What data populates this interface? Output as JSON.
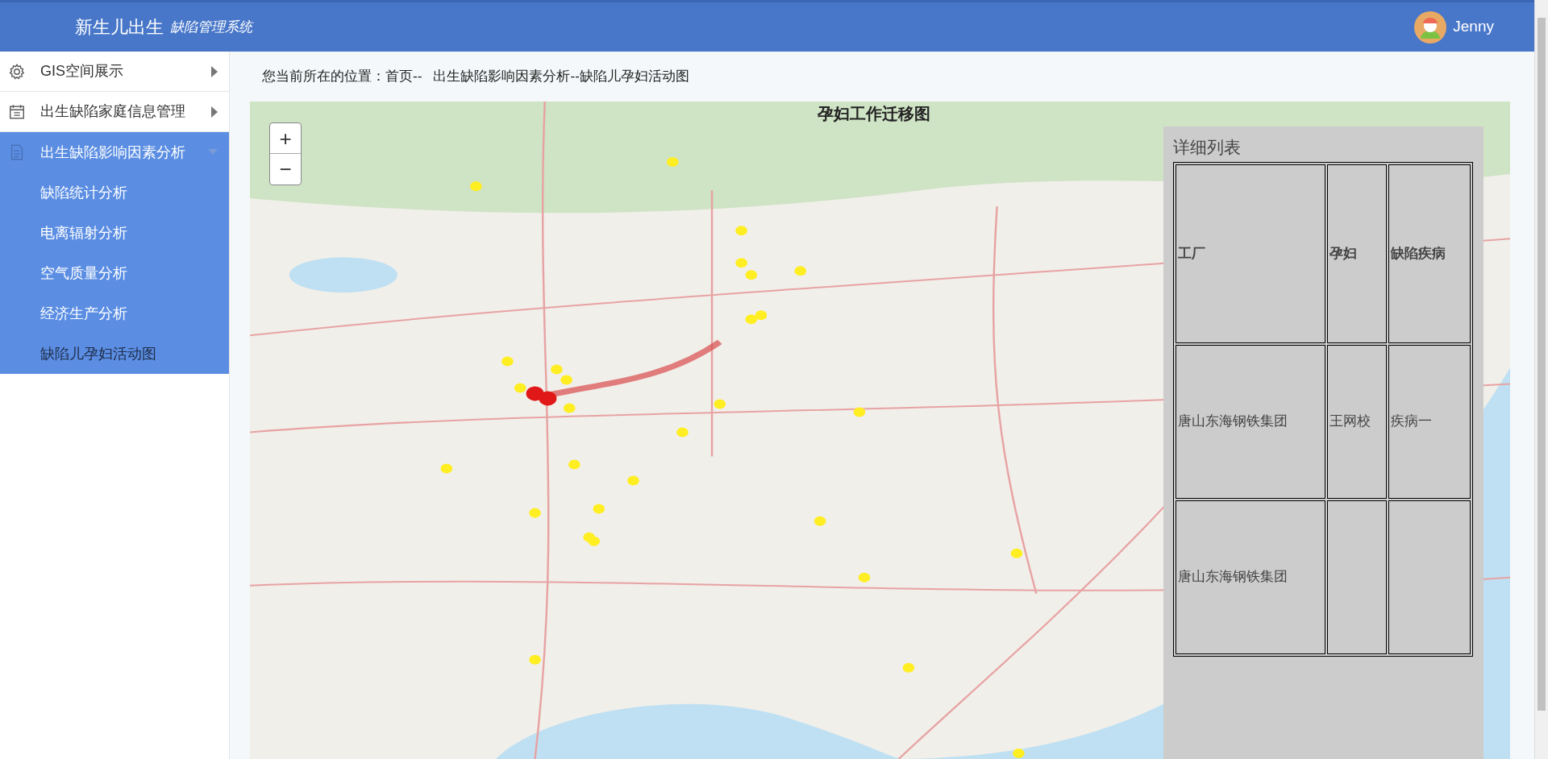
{
  "header": {
    "title": "新生儿出生",
    "subtitle": "缺陷管理系统",
    "user": "Jenny"
  },
  "sidebar": {
    "items": [
      {
        "label": "GIS空间展示",
        "kind": "gear",
        "expanded": false
      },
      {
        "label": "出生缺陷家庭信息管理",
        "kind": "calendar",
        "expanded": false
      },
      {
        "label": "出生缺陷影响因素分析",
        "kind": "document",
        "expanded": true,
        "children": [
          {
            "label": "缺陷统计分析",
            "selected": false
          },
          {
            "label": "电离辐射分析",
            "selected": false
          },
          {
            "label": "空气质量分析",
            "selected": false
          },
          {
            "label": "经济生产分析",
            "selected": false
          },
          {
            "label": "缺陷儿孕妇活动图",
            "selected": true
          }
        ]
      }
    ]
  },
  "breadcrumb": "您当前所在的位置：首页--   出生缺陷影响因素分析--缺陷儿孕妇活动图",
  "map": {
    "title": "孕妇工作迁移图",
    "zoom_in": "+",
    "zoom_out": "−"
  },
  "detail_panel": {
    "title": "详细列表",
    "columns": [
      "工厂",
      "孕妇",
      "缺陷疾病"
    ],
    "rows": [
      [
        "唐山东海钢铁集团",
        "王网校",
        "疾病一"
      ],
      [
        "唐山东海钢铁集团"
      ]
    ]
  }
}
